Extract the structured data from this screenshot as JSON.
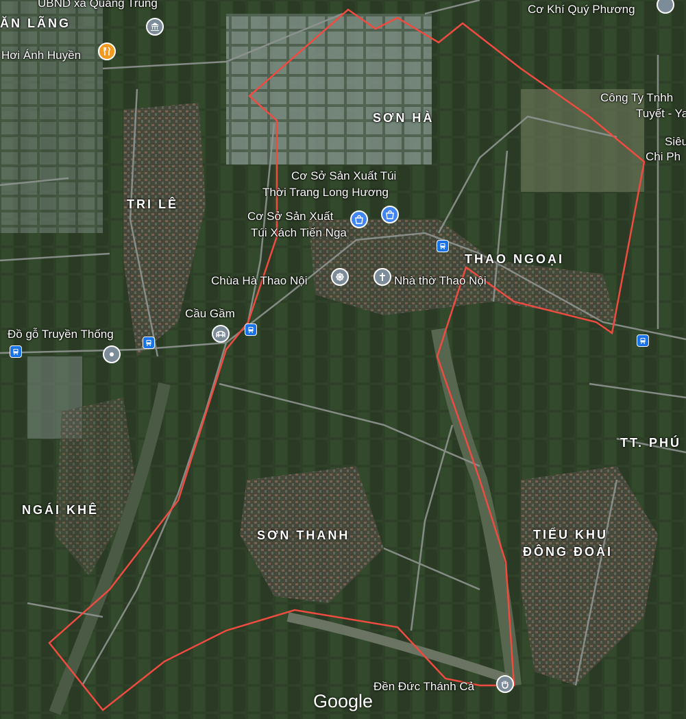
{
  "map": {
    "attribution": "Google",
    "boundary_color": "#e8433a",
    "area_labels": {
      "son_ha": "SƠN HÀ",
      "tri_le": "TRI LÊ",
      "thao_ngoai": "THAO NGOẠI",
      "ngai_khe": "NGÁI KHÊ",
      "son_thanh": "SƠN THANH",
      "tieu_khu_line1": "TIỂU KHU",
      "tieu_khu_line2": "ĐÔNG ĐOÀI",
      "tt_phu": "TT. PHÚ",
      "an_lang": "ĂN LÃNG"
    },
    "poi_labels": {
      "ubnd": "UBND xã Quảng Trung",
      "hoi_anh_huyen": "Hơi Ánh Huyền",
      "co_khi": "Cơ Khí Quý Phương",
      "cong_ty_line1": "Công Ty Tnhh",
      "cong_ty_line2": "Tuyết - Yam",
      "sieu_line1": "Siêu",
      "sieu_line2": "Chi Ph",
      "long_huong_line1": "Cơ Sở Sản Xuất Túi",
      "long_huong_line2": "Thời Trang Long Hương",
      "tien_nga_line1": "Cơ Sở Sản Xuất",
      "tien_nga_line2": "Túi Xách Tiến Nga",
      "chua": "Chùa Hà Thao Nội",
      "nha_tho": "Nhà thờ Thao Nội",
      "cau_gam": "Cầu Gầm",
      "do_go": "Đồ gỗ Truyền Thống",
      "den": "Đền Đức Thánh Cả"
    },
    "icons": {
      "government": "government-building-icon",
      "restaurant": "restaurant-icon",
      "shopping": "shopping-bag-icon",
      "buddhist": "dharma-wheel-icon",
      "church": "church-cross-icon",
      "bridge": "bridge-icon",
      "place": "place-pin-icon",
      "shrine": "shrine-hand-icon",
      "bus": "bus-stop-icon"
    },
    "colors": {
      "pin_gray": "#7d8c99",
      "pin_orange": "#f29a1f",
      "pin_blue": "#4285f4",
      "bus_blue": "#1a73e8"
    }
  }
}
